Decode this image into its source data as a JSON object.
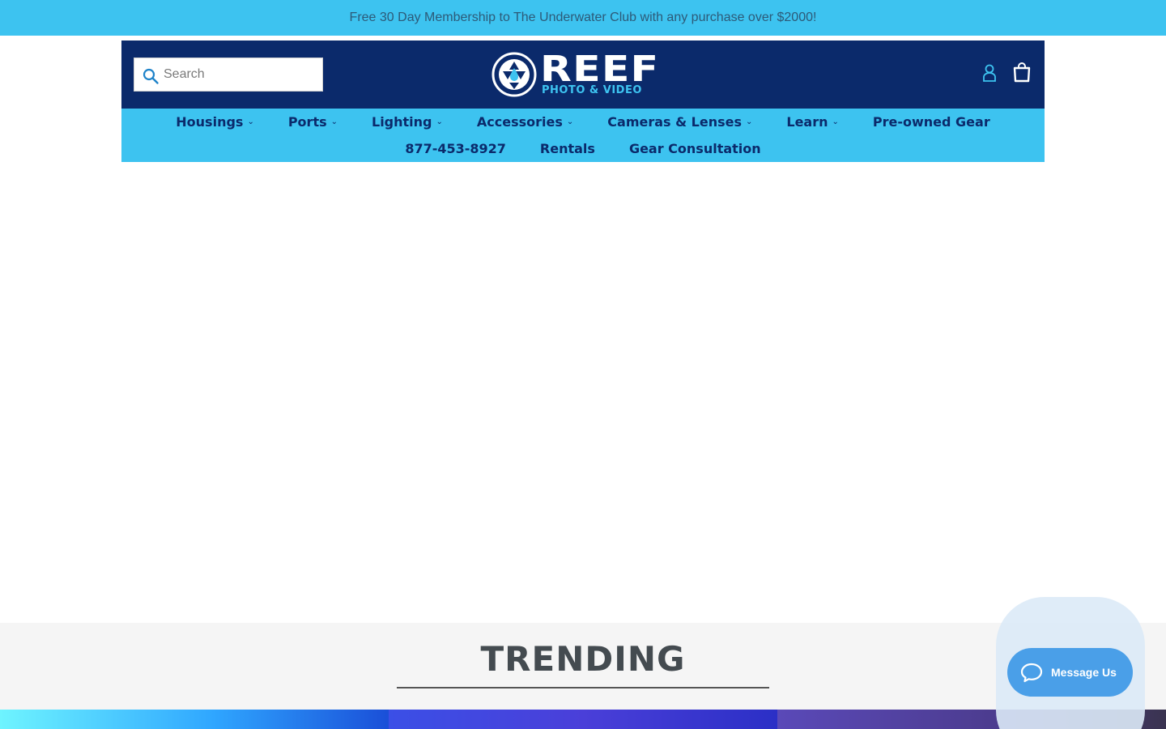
{
  "announcement": "Free 30 Day Membership to The Underwater Club with any purchase over $2000!",
  "search": {
    "placeholder": "Search"
  },
  "logo": {
    "word": "REEF",
    "sub": "PHOTO & VIDEO"
  },
  "nav": {
    "row1": [
      {
        "label": "Housings",
        "dropdown": true
      },
      {
        "label": "Ports",
        "dropdown": true
      },
      {
        "label": "Lighting",
        "dropdown": true
      },
      {
        "label": "Accessories",
        "dropdown": true
      },
      {
        "label": "Cameras & Lenses",
        "dropdown": true
      },
      {
        "label": "Learn",
        "dropdown": true
      },
      {
        "label": "Pre-owned Gear",
        "dropdown": false
      }
    ],
    "row2": [
      {
        "label": "877-453-8927",
        "dropdown": false
      },
      {
        "label": "Rentals",
        "dropdown": false
      },
      {
        "label": "Gear Consultation",
        "dropdown": false
      }
    ]
  },
  "trending": {
    "title": "TRENDING"
  },
  "chat": {
    "label": "Message Us"
  },
  "colors": {
    "announce_bg": "#3dc3f0",
    "header_bg": "#0b2a6b",
    "nav_bg": "#3dc3f0",
    "accent": "#3dc3f0",
    "chat_bg": "#4a9fe8"
  },
  "icons": {
    "search": "search-icon",
    "account": "account-icon",
    "cart": "cart-icon",
    "chat": "chat-icon",
    "dropdown": "chevron-down-icon"
  }
}
